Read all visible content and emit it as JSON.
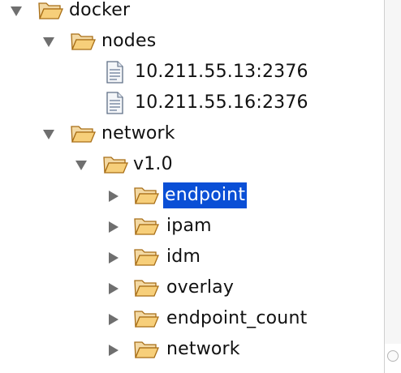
{
  "tree": {
    "nodes": [
      {
        "label": "docker",
        "icon": "folder-open-icon",
        "toggle": "expanded"
      },
      {
        "label": "nodes",
        "icon": "folder-open-icon",
        "toggle": "expanded"
      },
      {
        "label": "10.211.55.13:2376",
        "icon": "file-icon",
        "toggle": "none"
      },
      {
        "label": "10.211.55.16:2376",
        "icon": "file-icon",
        "toggle": "none"
      },
      {
        "label": "network",
        "icon": "folder-open-icon",
        "toggle": "expanded"
      },
      {
        "label": "v1.0",
        "icon": "folder-open-icon",
        "toggle": "expanded"
      },
      {
        "label": "endpoint",
        "icon": "folder-closed-icon",
        "toggle": "collapsed",
        "selected": true
      },
      {
        "label": "ipam",
        "icon": "folder-closed-icon",
        "toggle": "collapsed"
      },
      {
        "label": "idm",
        "icon": "folder-closed-icon",
        "toggle": "collapsed"
      },
      {
        "label": "overlay",
        "icon": "folder-closed-icon",
        "toggle": "collapsed"
      },
      {
        "label": "endpoint_count",
        "icon": "folder-closed-icon",
        "toggle": "collapsed"
      },
      {
        "label": "network",
        "icon": "folder-closed-icon",
        "toggle": "collapsed"
      }
    ]
  },
  "colors": {
    "selection_bg": "#0a4fd6",
    "selection_text": "#ffffff",
    "folder_fill": "#f7cf7a",
    "folder_stroke": "#a86e16",
    "toggle_fill": "#6f6f6f"
  }
}
